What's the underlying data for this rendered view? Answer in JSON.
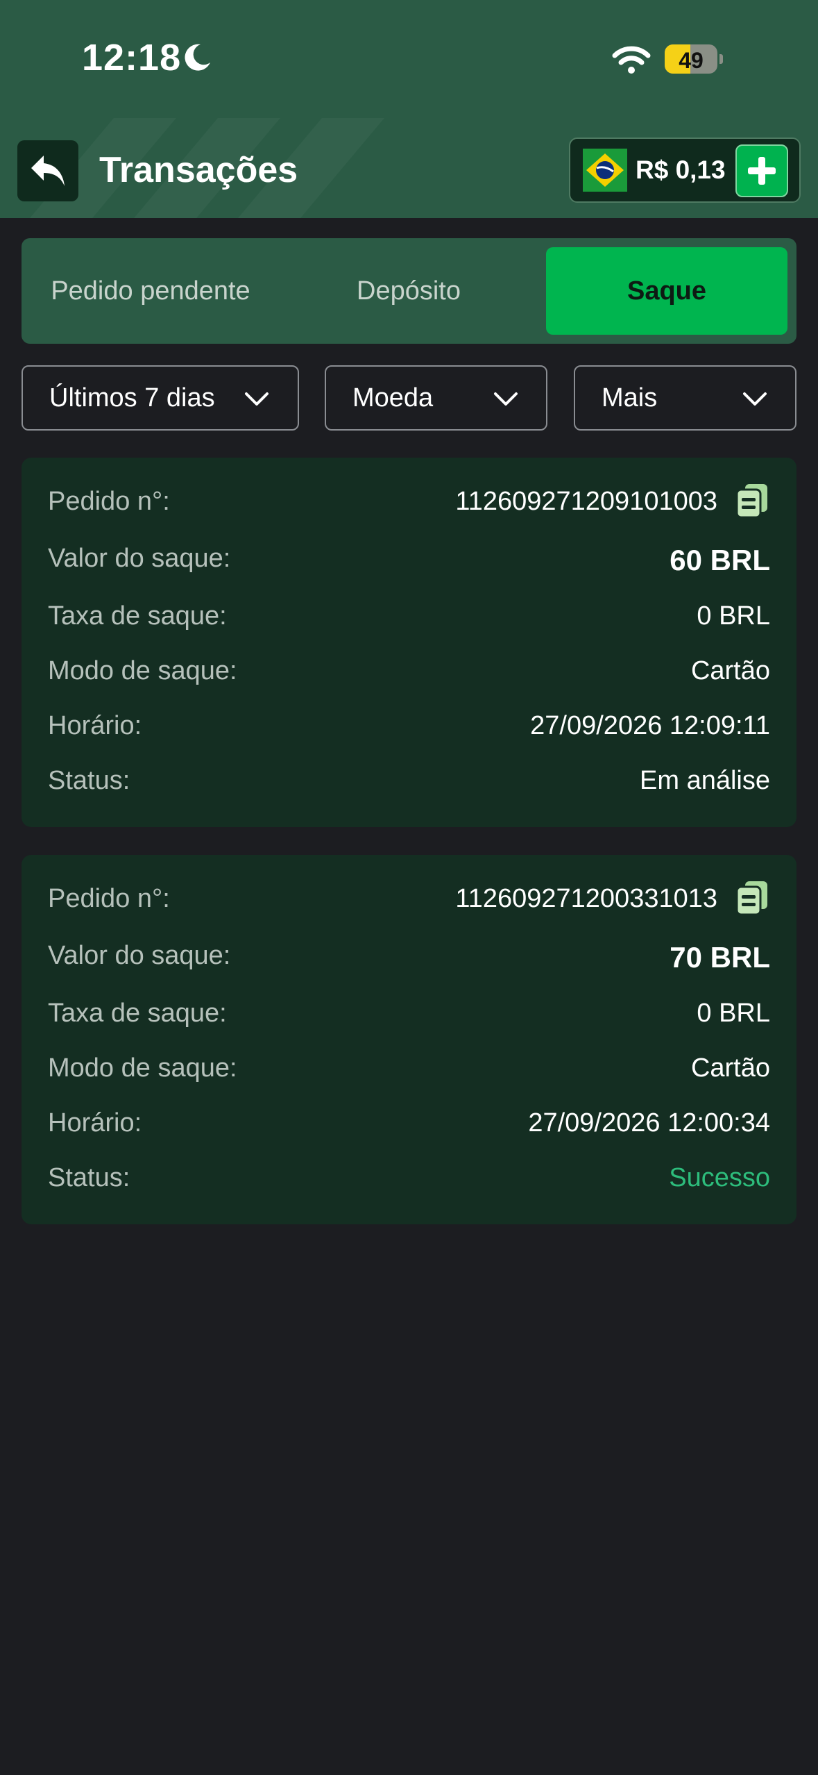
{
  "status_bar": {
    "time": "12:18",
    "battery": "49",
    "battery_level": 0.49
  },
  "header": {
    "title": "Transações",
    "balance": "R$ 0,13",
    "back_icon": "back-arrow-icon",
    "add_icon": "plus-icon",
    "flag_icon": "brazil-flag-icon"
  },
  "tabs": [
    {
      "label": "Pedido pendente",
      "active": false
    },
    {
      "label": "Depósito",
      "active": false
    },
    {
      "label": "Saque",
      "active": true
    }
  ],
  "filters": [
    {
      "label": "Últimos 7 dias"
    },
    {
      "label": "Moeda"
    },
    {
      "label": "Mais"
    }
  ],
  "labels": {
    "order_no": "Pedido n°:",
    "amount": "Valor do saque:",
    "fee": "Taxa de saque:",
    "mode": "Modo de saque:",
    "time": "Horário:",
    "status": "Status:"
  },
  "transactions": [
    {
      "order_no": "112609271209101003",
      "amount": "60 BRL",
      "fee": "0 BRL",
      "mode": "Cartão",
      "time": "27/09/2026 12:09:11",
      "status": "Em análise"
    },
    {
      "order_no": "112609271200331013",
      "amount": "70 BRL",
      "fee": "0 BRL",
      "mode": "Cartão",
      "time": "27/09/2026 12:00:34",
      "status": "Sucesso"
    }
  ],
  "colors": {
    "header_green": "#2b5b45",
    "accent_green": "#00b54f",
    "card_bg": "#142e22",
    "success": "#2dbd7c",
    "background": "#1c1d21"
  }
}
